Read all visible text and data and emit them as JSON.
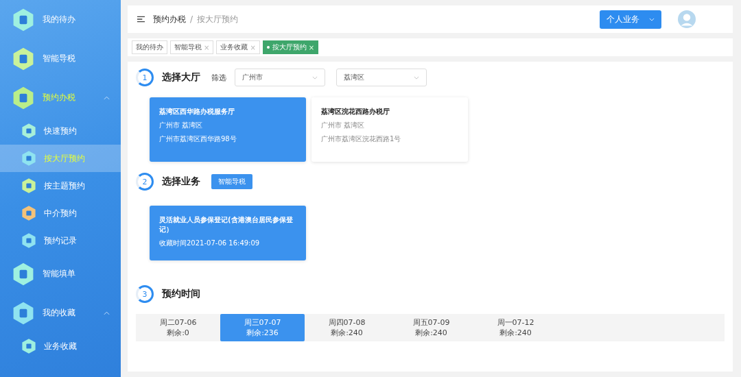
{
  "sidebar": {
    "items": [
      {
        "label": "我的待办",
        "selected": false
      },
      {
        "label": "智能导税",
        "selected": false
      },
      {
        "label": "预约办税",
        "selected": false,
        "expanded": true,
        "children": [
          {
            "label": "快速预约",
            "selected": false
          },
          {
            "label": "按大厅预约",
            "selected": true
          },
          {
            "label": "按主题预约",
            "selected": false
          },
          {
            "label": "中介预约",
            "selected": false
          },
          {
            "label": "预约记录",
            "selected": false
          }
        ]
      },
      {
        "label": "智能填单",
        "selected": false
      },
      {
        "label": "我的收藏",
        "selected": false,
        "expanded": true,
        "children": [
          {
            "label": "业务收藏",
            "selected": false
          }
        ]
      }
    ]
  },
  "header": {
    "breadcrumb": [
      "预约办税",
      "按大厅预约"
    ],
    "breadcrumb_separator": "/",
    "business_button": "个人业务"
  },
  "tabs": [
    {
      "label": "我的待办",
      "selected": false
    },
    {
      "label": "智能导税",
      "close": "×",
      "selected": false
    },
    {
      "label": "业务收藏",
      "close": "×",
      "selected": false
    },
    {
      "label": "按大厅预约",
      "close": "×",
      "selected": true
    }
  ],
  "step1": {
    "number": "1",
    "title": "选择大厅",
    "filter_label": "筛选",
    "city": "广州市",
    "district": "荔湾区",
    "halls": [
      {
        "name": "荔湾区西华路办税服务厅",
        "area": "广州市 荔湾区",
        "address": "广州市荔湾区西华路98号",
        "selected": true
      },
      {
        "name": "荔湾区浣花西路办税厅",
        "area": "广州市 荔湾区",
        "address": "广州市荔湾区浣花西路1号",
        "selected": false
      }
    ]
  },
  "step2": {
    "number": "2",
    "title": "选择业务",
    "guide_button": "智能导税",
    "services": [
      {
        "name": "灵活就业人员参保登记(含港澳台居民参保登记）",
        "time": "收藏时间2021-07-06 16:49:09",
        "selected": true
      }
    ]
  },
  "step3": {
    "number": "3",
    "title": "预约时间",
    "dates": [
      {
        "day": "周二07-06",
        "remaining": "剩余:0",
        "selected": false
      },
      {
        "day": "周三07-07",
        "remaining": "剩余:236",
        "selected": true
      },
      {
        "day": "周四07-08",
        "remaining": "剩余:240",
        "selected": false
      },
      {
        "day": "周五07-09",
        "remaining": "剩余:240",
        "selected": false
      },
      {
        "day": "周一07-12",
        "remaining": "剩余:240",
        "selected": false
      }
    ]
  }
}
